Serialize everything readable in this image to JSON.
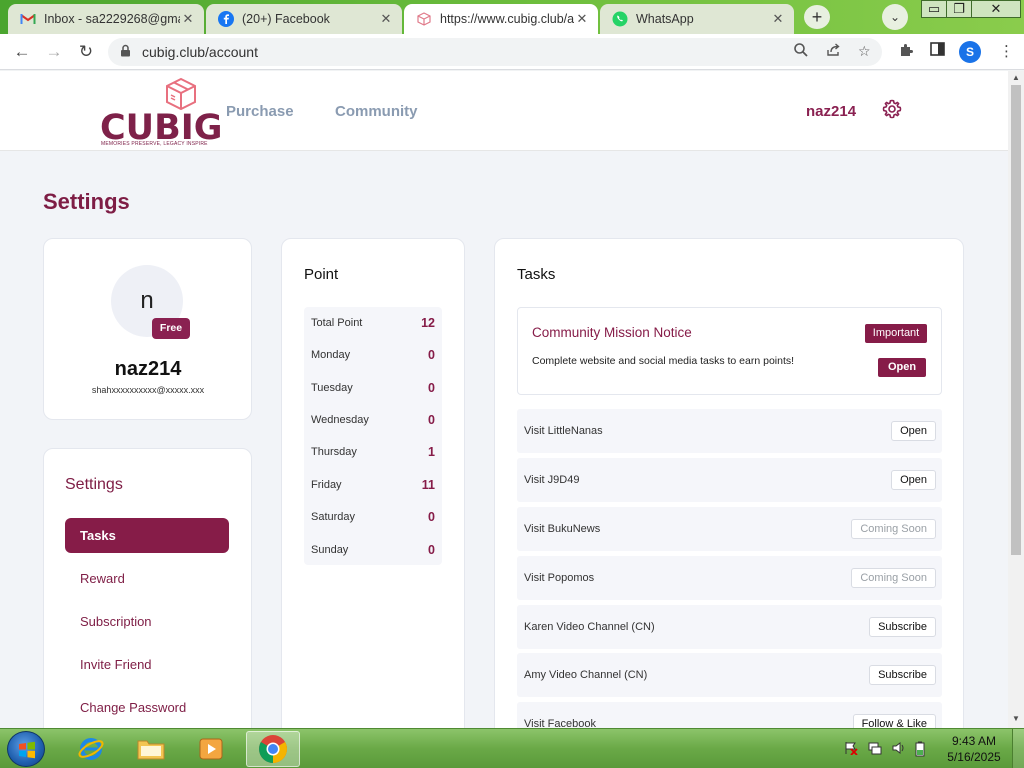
{
  "browser": {
    "tabs": [
      {
        "title": "Inbox - sa2229268@gma",
        "icon": "gmail-icon",
        "active": false
      },
      {
        "title": "(20+) Facebook",
        "icon": "facebook-icon",
        "active": false
      },
      {
        "title": "https://www.cubig.club/a",
        "icon": "cubig-icon",
        "active": true
      },
      {
        "title": "WhatsApp",
        "icon": "whatsapp-icon",
        "active": false
      }
    ],
    "url": "cubig.club/account",
    "profile_initial": "S"
  },
  "site": {
    "logo_word": "CUBIG",
    "logo_tagline": "MEMORIES PRESERVE, LEGACY INSPIRE",
    "nav": [
      "Purchase",
      "Community"
    ],
    "username": "naz214",
    "brand_color": "#861c48"
  },
  "page": {
    "title": "Settings"
  },
  "profile": {
    "initial": "n",
    "badge": "Free",
    "username": "naz214",
    "email": "shahxxxxxxxxxx@xxxxx.xxx"
  },
  "settings_menu": {
    "heading": "Settings",
    "items": [
      "Tasks",
      "Reward",
      "Subscription",
      "Invite Friend",
      "Change Password"
    ],
    "active": "Tasks"
  },
  "points": {
    "heading": "Point",
    "rows": [
      {
        "label": "Total Point",
        "value": "12"
      },
      {
        "label": "Monday",
        "value": "0"
      },
      {
        "label": "Tuesday",
        "value": "0"
      },
      {
        "label": "Wednesday",
        "value": "0"
      },
      {
        "label": "Thursday",
        "value": "1"
      },
      {
        "label": "Friday",
        "value": "11"
      },
      {
        "label": "Saturday",
        "value": "0"
      },
      {
        "label": "Sunday",
        "value": "0"
      }
    ]
  },
  "tasks": {
    "heading": "Tasks",
    "notice": {
      "title": "Community Mission Notice",
      "badge": "Important",
      "description": "Complete website and social media tasks to earn points!",
      "button": "Open"
    },
    "items": [
      {
        "label": "Visit LittleNanas",
        "button": "Open",
        "disabled": false
      },
      {
        "label": "Visit J9D49",
        "button": "Open",
        "disabled": false
      },
      {
        "label": "Visit BukuNews",
        "button": "Coming Soon",
        "disabled": true
      },
      {
        "label": "Visit Popomos",
        "button": "Coming Soon",
        "disabled": true
      },
      {
        "label": "Karen Video Channel (CN)",
        "button": "Subscribe",
        "disabled": false
      },
      {
        "label": "Amy Video Channel (CN)",
        "button": "Subscribe",
        "disabled": false
      },
      {
        "label": "Visit Facebook",
        "button": "Follow & Like",
        "disabled": false
      }
    ]
  },
  "taskbar": {
    "time": "9:43 AM",
    "date": "5/16/2025"
  }
}
